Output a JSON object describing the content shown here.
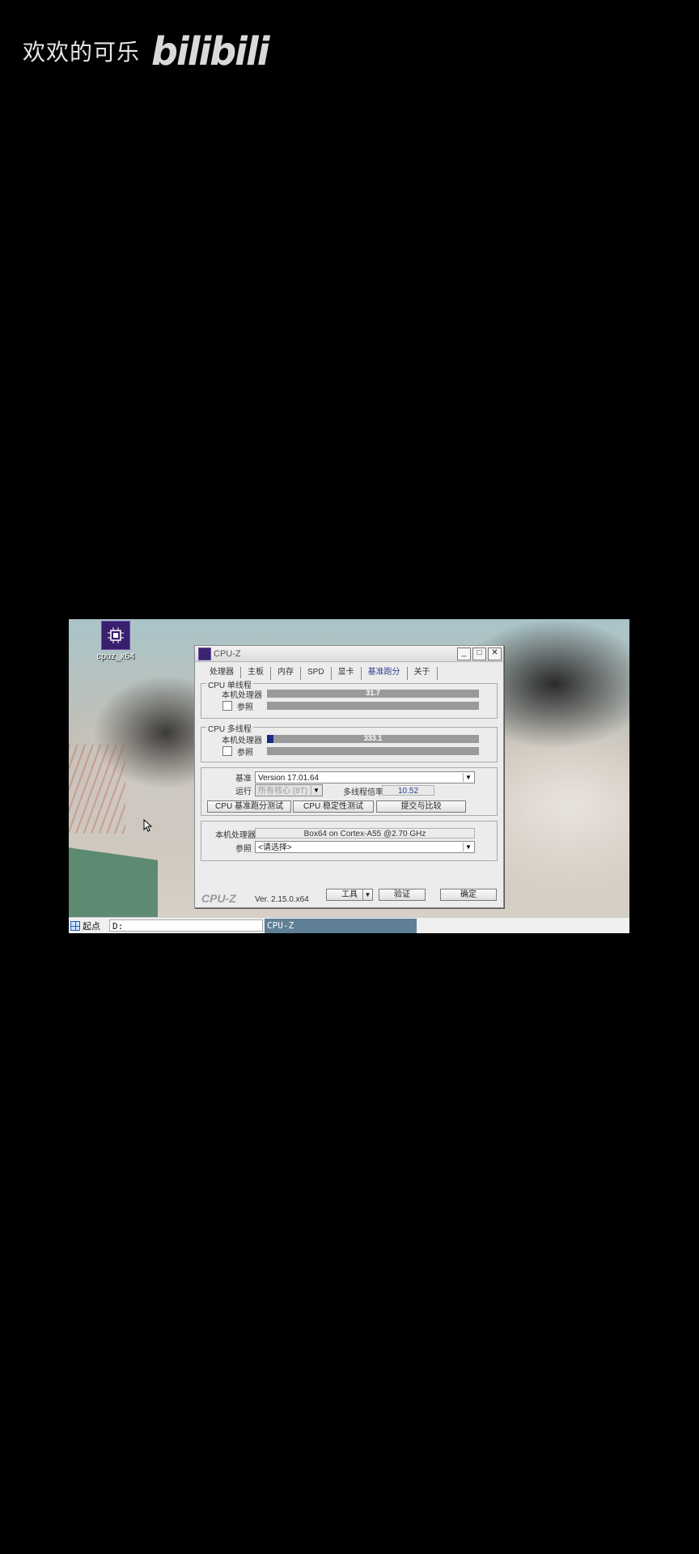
{
  "watermark": {
    "user": "欢欢的可乐",
    "logo": "bilibili"
  },
  "desktop": {
    "icon_label": "cpuz_x64"
  },
  "window": {
    "title": "CPU-Z",
    "controls": {
      "minimize": "_",
      "maximize": "□",
      "close": "✕"
    },
    "tabs": [
      "处理器",
      "主板",
      "内存",
      "SPD",
      "显卡",
      "基准跑分",
      "关于"
    ],
    "active_tab": "基准跑分",
    "single_thread": {
      "title": "CPU 单线程",
      "this_cpu_label": "本机处理器",
      "this_cpu_value": "31.7",
      "reference_label": "参照"
    },
    "multi_thread": {
      "title": "CPU 多线程",
      "this_cpu_label": "本机处理器",
      "this_cpu_value": "333.1",
      "this_cpu_fill_fraction": 0.03,
      "reference_label": "参照"
    },
    "settings": {
      "benchmark_label": "基准",
      "benchmark_value": "Version 17.01.64",
      "threads_label": "运行",
      "threads_value": "所有核心 (8T)",
      "ratio_label": "多线程倍率",
      "ratio_value": "10.52",
      "bench_button": "CPU 基准跑分测试",
      "stress_button": "CPU 稳定性测试",
      "submit_button": "提交与比较"
    },
    "processor": {
      "this_cpu_label": "本机处理器",
      "this_cpu_value": "Box64 on Cortex-A55 @2.70 GHz",
      "reference_label": "参照",
      "reference_value": "<请选择>"
    },
    "footer": {
      "logo": "CPU-Z",
      "version": "Ver. 2.15.0.x64",
      "tools_button": "工具",
      "validate_button": "验证",
      "ok_button": "确定"
    }
  },
  "taskbar": {
    "start_label": "起点",
    "address_value": "D:",
    "task_label": "CPU-Z"
  }
}
